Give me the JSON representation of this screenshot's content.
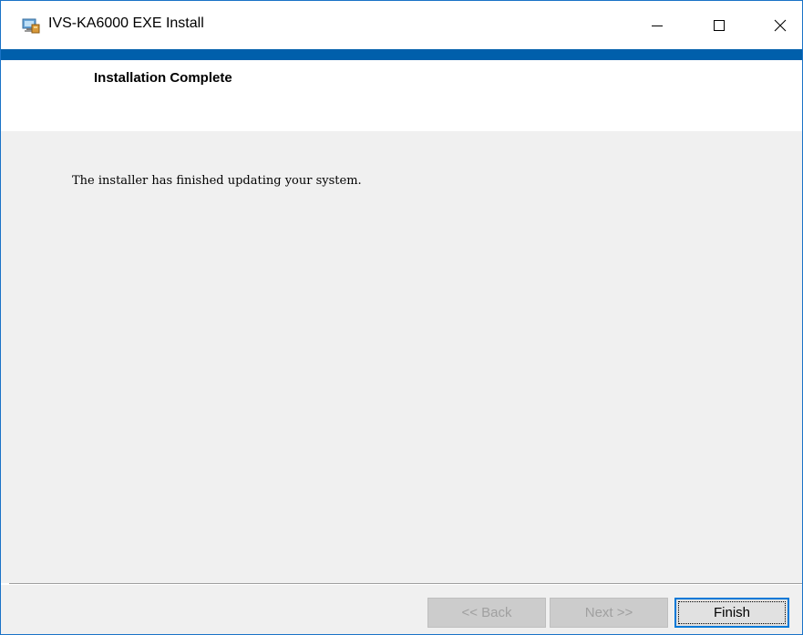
{
  "window": {
    "title": "IVS-KA6000 EXE Install",
    "accent_color": "#005fab"
  },
  "caption_buttons": {
    "minimize": "minimize-icon",
    "maximize": "maximize-icon",
    "close": "close-icon"
  },
  "header": {
    "title": "Installation Complete"
  },
  "body": {
    "message": "The installer has finished updating your system."
  },
  "footer": {
    "back_label": "<< Back",
    "next_label": "Next >>",
    "finish_label": "Finish",
    "back_enabled": false,
    "next_enabled": false,
    "finish_enabled": true
  }
}
